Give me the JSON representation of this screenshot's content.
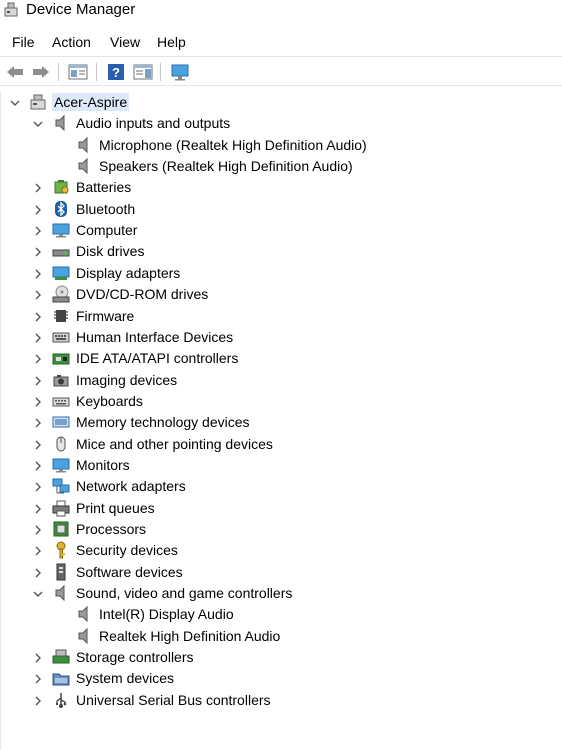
{
  "window": {
    "title": "Device Manager"
  },
  "menu": [
    "File",
    "Action",
    "View",
    "Help"
  ],
  "toolbar": {
    "buttons": [
      "back-arrow-icon",
      "forward-arrow-icon",
      "properties-pane-icon",
      "help-icon",
      "action-pane-icon",
      "monitor-scan-icon"
    ]
  },
  "tree": {
    "root": {
      "label": "Acer-Aspire",
      "icon": "computer-icon",
      "expanded": true
    },
    "categories": [
      {
        "label": "Audio inputs and outputs",
        "icon": "speaker-icon",
        "expanded": true,
        "children": [
          {
            "label": "Microphone (Realtek High Definition Audio)",
            "icon": "speaker-icon"
          },
          {
            "label": "Speakers (Realtek High Definition Audio)",
            "icon": "speaker-icon"
          }
        ]
      },
      {
        "label": "Batteries",
        "icon": "battery-icon",
        "expanded": false
      },
      {
        "label": "Bluetooth",
        "icon": "bluetooth-icon",
        "expanded": false
      },
      {
        "label": "Computer",
        "icon": "monitor-icon",
        "expanded": false
      },
      {
        "label": "Disk drives",
        "icon": "disk-drive-icon",
        "expanded": false
      },
      {
        "label": "Display adapters",
        "icon": "display-adapter-icon",
        "expanded": false
      },
      {
        "label": "DVD/CD-ROM drives",
        "icon": "dvd-drive-icon",
        "expanded": false
      },
      {
        "label": "Firmware",
        "icon": "chip-icon",
        "expanded": false
      },
      {
        "label": "Human Interface Devices",
        "icon": "hid-icon",
        "expanded": false
      },
      {
        "label": "IDE ATA/ATAPI controllers",
        "icon": "ide-controller-icon",
        "expanded": false
      },
      {
        "label": "Imaging devices",
        "icon": "camera-icon",
        "expanded": false
      },
      {
        "label": "Keyboards",
        "icon": "keyboard-icon",
        "expanded": false
      },
      {
        "label": "Memory technology devices",
        "icon": "memory-icon",
        "expanded": false
      },
      {
        "label": "Mice and other pointing devices",
        "icon": "mouse-icon",
        "expanded": false
      },
      {
        "label": "Monitors",
        "icon": "monitor-icon",
        "expanded": false
      },
      {
        "label": "Network adapters",
        "icon": "network-icon",
        "expanded": false
      },
      {
        "label": "Print queues",
        "icon": "printer-icon",
        "expanded": false
      },
      {
        "label": "Processors",
        "icon": "processor-icon",
        "expanded": false
      },
      {
        "label": "Security devices",
        "icon": "key-icon",
        "expanded": false
      },
      {
        "label": "Software devices",
        "icon": "software-device-icon",
        "expanded": false
      },
      {
        "label": "Sound, video and game controllers",
        "icon": "speaker-icon",
        "expanded": true,
        "children": [
          {
            "label": "Intel(R) Display Audio",
            "icon": "speaker-icon"
          },
          {
            "label": "Realtek High Definition Audio",
            "icon": "speaker-icon"
          }
        ]
      },
      {
        "label": "Storage controllers",
        "icon": "storage-controller-icon",
        "expanded": false
      },
      {
        "label": "System devices",
        "icon": "folder-icon",
        "expanded": false
      },
      {
        "label": "Universal Serial Bus controllers",
        "icon": "usb-icon",
        "expanded": false
      }
    ]
  },
  "colors": {
    "selection": "#dbe9f8",
    "chevron": "#555555",
    "accent": "#0078d7"
  }
}
